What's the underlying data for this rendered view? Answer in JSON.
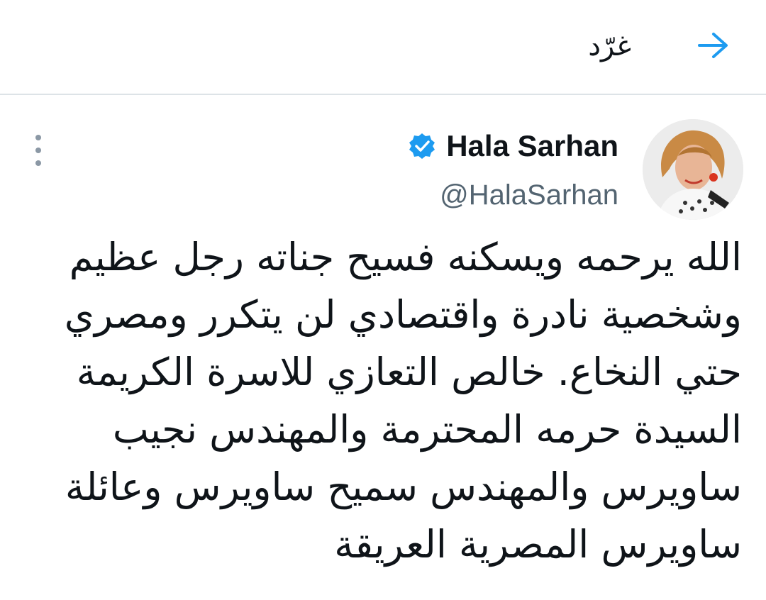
{
  "header": {
    "title": "غرّد",
    "back_icon": "arrow-right-icon",
    "accent_color": "#1d9bf0"
  },
  "tweet": {
    "author": {
      "name": "Hala Sarhan",
      "handle": "@HalaSarhan",
      "verified": true,
      "verified_color": "#1d9bf0"
    },
    "more_icon": "vertical-ellipsis-icon",
    "text_lines": [
      "الله يرحمه ويسكنه فسيح جناته رجل عظيم",
      "وشخصية نادرة واقتصادي لن يتكرر ومصري",
      "حتي النخاع. خالص التعازي للاسرة الكريمة",
      "السيدة حرمه المحترمة والمهندس نجيب",
      "ساويرس والمهندس سميح ساويرس وعائلة",
      "ساويرس المصرية العريقة"
    ]
  }
}
